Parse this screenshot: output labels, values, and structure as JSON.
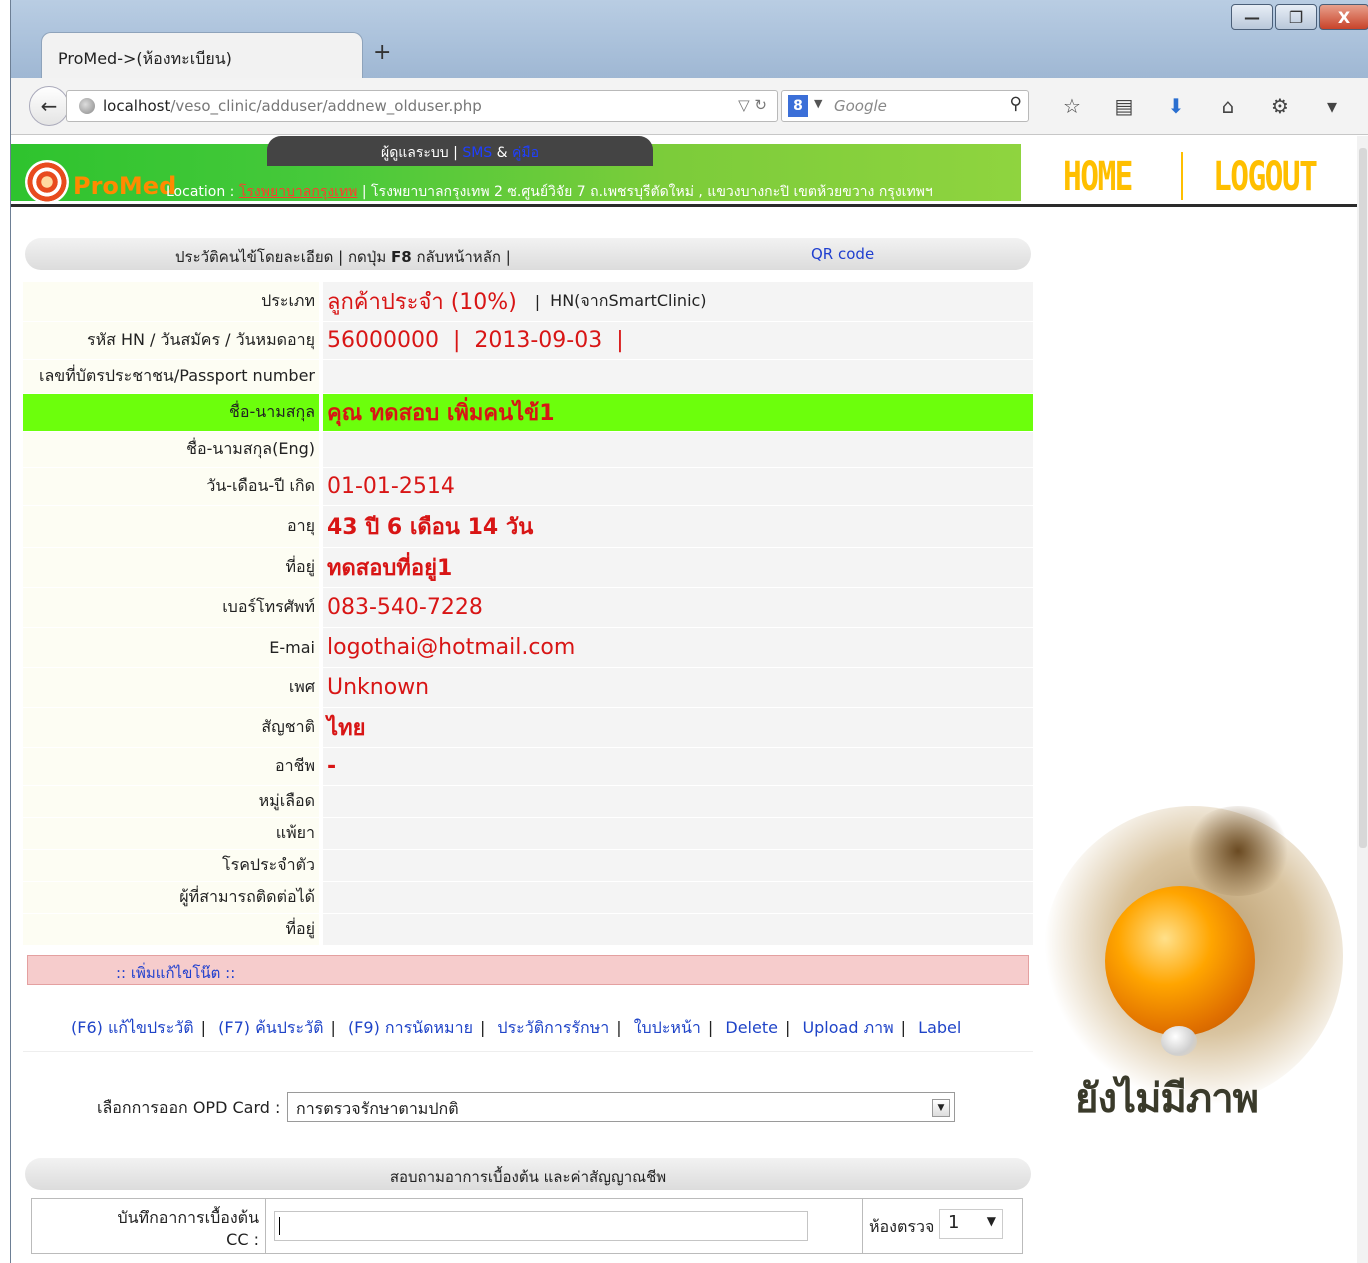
{
  "browser": {
    "tab_title": "ProMed->(ห้องทะเบียน)",
    "new_tab": "+",
    "url_host": "localhost",
    "url_path": "/veso_clinic/adduser/addnew_olduser.php",
    "search_placeholder": "Google",
    "window_buttons": [
      "—",
      "❐",
      "X"
    ]
  },
  "header": {
    "top_tab_prefix": "ผู้ดูแลระบบ | ",
    "top_tab_sms": "SMS",
    "top_tab_amp": " & ",
    "top_tab_manual": "คู่มือ",
    "logo": "ProMed",
    "location_label": "Location : ",
    "location_name": "โรงพยาบาลกรุงเทพ",
    "location_address": " | โรงพยาบาลกรุงเทพ 2 ซ.ศูนย์วิจัย 7 ถ.เพชรบุรีตัดใหม่ , แขวงบางกะปิ เขตห้วยขวาง กรุงเทพฯ",
    "home": "HOME",
    "logout": "LOGOUT"
  },
  "history_bar": {
    "text_a": "ประวัติคนไข้โดยละเอียด | กดปุ่ม ",
    "text_key": "F8",
    "text_b": " กลับหน้าหลัก |",
    "qr": "QR code"
  },
  "patient": {
    "type_label": "ประเภท",
    "type_value": "ลูกค้าประจำ (10%)",
    "type_sep": "|",
    "type_hn_note": "HN(จากSmartClinic)",
    "hn_label": "รหัส HN / วันสมัคร / วันหมดอายุ",
    "hn_value": "56000000  |  2013-09-03  |",
    "idcard_label": "เลขที่บัตรประชาชน/Passport number",
    "idcard_value": "",
    "name_label": "ชื่อ-นามสกุล",
    "name_value": "คุณ ทดสอบ เพิ่มคนไข้1",
    "name_eng_label": "ชื่อ-นามสกุล(Eng)",
    "name_eng_value": "",
    "birth_label": "วัน-เดือน-ปี เกิด",
    "birth_value": "01-01-2514",
    "age_label": "อายุ",
    "age_value": "43 ปี 6 เดือน 14 วัน",
    "address_label": "ที่อยู่",
    "address_value": "ทดสอบที่อยู่1",
    "phone_label": "เบอร์โทรศัพท์",
    "phone_value": "083-540-7228",
    "email_label": "E-mai",
    "email_value": "logothai@hotmail.com",
    "sex_label": "เพศ",
    "sex_value": "Unknown",
    "nationality_label": "สัญชาติ",
    "nationality_value": "ไทย",
    "occupation_label": "อาชีพ",
    "occupation_value": "-",
    "blood_label": "หมู่เลือด",
    "blood_value": "",
    "allergy_label": "แพ้ยา",
    "allergy_value": "",
    "disease_label": "โรคประจำตัว",
    "disease_value": "",
    "contact_label": "ผู้ที่สามารถติดต่อได้",
    "contact_value": "",
    "contact_address_label": "ที่อยู่",
    "contact_address_value": ""
  },
  "note_bar": ":: เพิ่มแก้ไขโน๊ต ::",
  "actions": [
    "(F6) แก้ไขประวัติ",
    "(F7) ค้นประวัติ",
    "(F9) การนัดหมาย",
    "ประวัติการรักษา",
    "ใบปะหน้า",
    "Delete",
    "Upload ภาพ",
    "Label"
  ],
  "actions_sep": "|",
  "opd": {
    "label": "เลือกการออก OPD Card :",
    "selected": "การตรวจรักษาตามปกติ"
  },
  "vitals_bar": "สอบถามอาการเบื้องต้น และค่าสัญญาณชีพ",
  "cc": {
    "label_line1": "บันทึกอาการเบื้องต้น",
    "label_line2": "CC :",
    "value": "",
    "room_label": "ห้องตรวจ",
    "room_value": "1"
  },
  "photo_caption": "ยังไม่มีภาพ",
  "colors": {
    "value_red": "#d81515",
    "highlight_green": "#6cff0c",
    "link_blue": "#1f44c8",
    "nav_gold": "#ffbf00"
  }
}
